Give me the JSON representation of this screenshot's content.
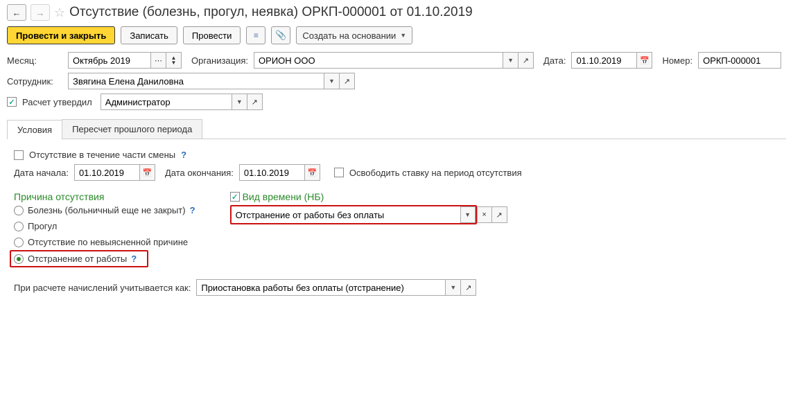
{
  "title": "Отсутствие (болезнь, прогул, неявка) ОРКП-000001 от 01.10.2019",
  "toolbar": {
    "post_close": "Провести и закрыть",
    "write": "Записать",
    "post": "Провести",
    "create_based": "Создать на основании"
  },
  "labels": {
    "month": "Месяц:",
    "org": "Организация:",
    "date": "Дата:",
    "number": "Номер:",
    "employee": "Сотрудник:",
    "calc_approved": "Расчет утвердил",
    "absence_part_shift": "Отсутствие в течение части смены",
    "date_start": "Дата начала:",
    "date_end": "Дата окончания:",
    "release_rate": "Освободить ставку на период отсутствия",
    "reason_title": "Причина отсутствия",
    "time_type_title": "Вид времени (НБ)",
    "calc_as": "При расчете начислений учитывается как:"
  },
  "values": {
    "month": "Октябрь 2019",
    "org": "ОРИОН ООО",
    "date": "01.10.2019",
    "number": "ОРКП-000001",
    "employee": "Звягина Елена Даниловна",
    "approver": "Администратор",
    "date_start": "01.10.2019",
    "date_end": "01.10.2019",
    "time_type": "Отстранение от работы без оплаты",
    "calc_as": "Приостановка работы без оплаты (отстранение)"
  },
  "tabs": {
    "conditions": "Условия",
    "recalc": "Пересчет прошлого периода"
  },
  "reasons": {
    "illness": "Болезнь (больничный еще не закрыт)",
    "truancy": "Прогул",
    "unknown": "Отсутствие по невыясненной причине",
    "suspension": "Отстранение от работы"
  }
}
